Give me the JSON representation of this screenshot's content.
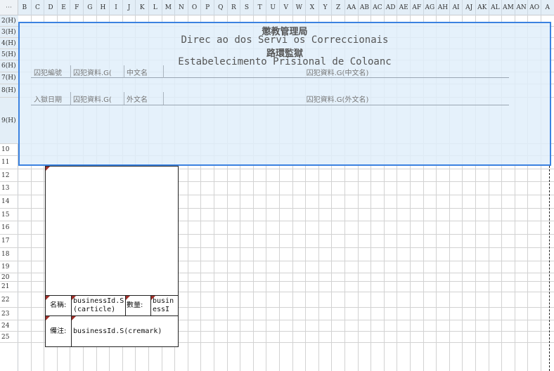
{
  "sheet": {
    "corner_icon": "grid-menu-icon",
    "columns": [
      "B",
      "C",
      "D",
      "E",
      "F",
      "G",
      "H",
      "I",
      "J",
      "K",
      "L",
      "M",
      "N",
      "O",
      "P",
      "Q",
      "R",
      "S",
      "T",
      "U",
      "V",
      "W",
      "X",
      "Y",
      "Z",
      "AA",
      "AB",
      "AC",
      "AD",
      "AE",
      "AF",
      "AG",
      "AH",
      "AI",
      "AJ",
      "AK",
      "AL",
      "AM",
      "AN",
      "AO",
      "A"
    ],
    "rows": [
      "2(H)",
      "3(H)",
      "4(H)",
      "5(H)",
      "6(H)",
      "7(H)",
      "8(H)",
      "9(H)",
      "10",
      "11",
      "12",
      "13",
      "14",
      "15",
      "16",
      "17",
      "18",
      "19",
      "20",
      "21",
      "22",
      "23",
      "24",
      "25"
    ]
  },
  "header_band": {
    "line1": "懲教管理局",
    "line2": "Direc ao dos Servi os Correccionais",
    "line3": "路環監獄",
    "line4": "Estabelecimento Prisional de Coloanc",
    "row6": {
      "label1": "囚犯編號",
      "value1": "囚犯資料.G(",
      "label2": "中文名",
      "value2": "囚犯資料.G(中文名)"
    },
    "row8": {
      "label1": "入獄日期",
      "value1": "囚犯資料.G(",
      "label2": "外文名",
      "value2": "囚犯資料.G(外文名)"
    }
  },
  "card": {
    "name_label": "名稱:",
    "name_value": "businessId.S(carticle)",
    "qty_label": "數量:",
    "qty_value": "businessI",
    "remark_label": "備注:",
    "remark_value": "businessId.S(cremark)"
  },
  "colors": {
    "selection_border": "#3b82e0",
    "selection_fill": "#e1eefa",
    "comment_marker": "#a0302a"
  }
}
